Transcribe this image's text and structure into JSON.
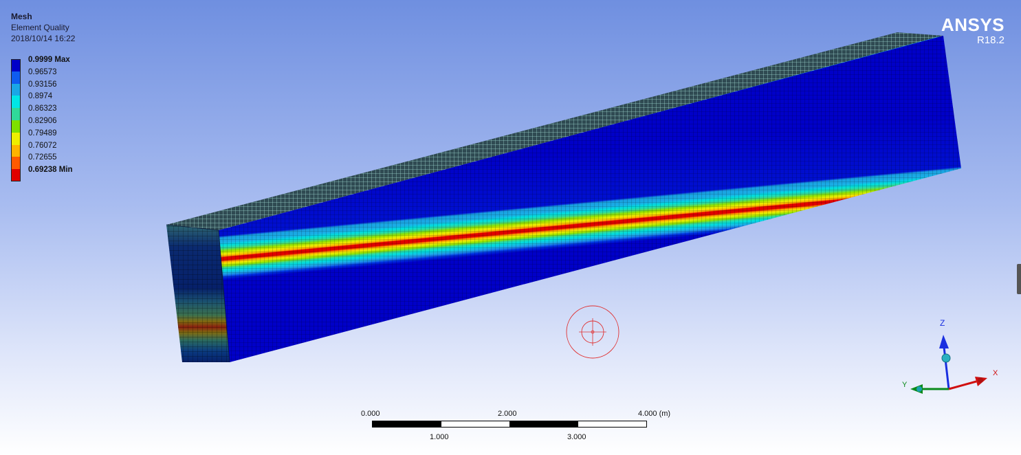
{
  "info": {
    "title": "Mesh",
    "subtitle": "Element Quality",
    "timestamp": "2018/10/14 16:22"
  },
  "legend": {
    "items": [
      {
        "label": "0.9999 Max",
        "color": "#0000c8",
        "bold": true
      },
      {
        "label": "0.96573",
        "color": "#0f5cf0",
        "bold": false
      },
      {
        "label": "0.93156",
        "color": "#1aa7e6",
        "bold": false
      },
      {
        "label": "0.8974",
        "color": "#00e6e6",
        "bold": false
      },
      {
        "label": "0.86323",
        "color": "#2fd99a",
        "bold": false
      },
      {
        "label": "0.82906",
        "color": "#7fe000",
        "bold": false
      },
      {
        "label": "0.79489",
        "color": "#eeee00",
        "bold": false
      },
      {
        "label": "0.76072",
        "color": "#ffb400",
        "bold": false
      },
      {
        "label": "0.72655",
        "color": "#ff5a00",
        "bold": false
      },
      {
        "label": "0.69238 Min",
        "color": "#e00000",
        "bold": true
      }
    ]
  },
  "logo": {
    "brand": "ANSYS",
    "version": "R18.2"
  },
  "scale": {
    "top_labels": [
      "0.000",
      "2.000",
      "4.000 (m)"
    ],
    "bottom_labels": [
      "1.000",
      "3.000"
    ]
  },
  "triad": {
    "x_label": "X",
    "y_label": "Y",
    "z_label": "Z"
  },
  "colors": {
    "background_top": "#6f8fe0",
    "background_bottom": "#ffffff",
    "logo": "#ffffff"
  }
}
